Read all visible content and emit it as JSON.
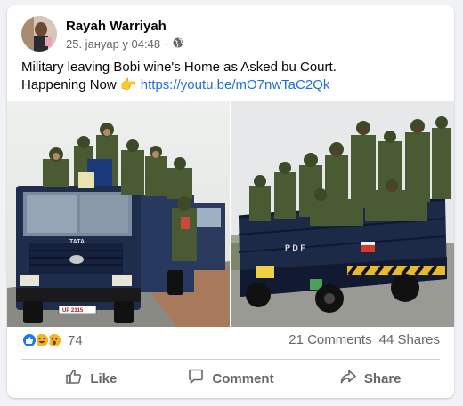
{
  "post": {
    "author": "Rayah Warriyah",
    "date": "25. јануар у 04:48",
    "separator": "·",
    "privacy_icon": "globe-icon",
    "text_line1": "Military leaving Bobi wine's Home as Asked bu Court.",
    "text_line2_prefix": "Happening Now ",
    "emoji": "👉",
    "link": "https://youtu.be/mO7nwTaC2Qk"
  },
  "stats": {
    "reaction_icons": [
      "like-icon",
      "haha-icon",
      "wow-icon"
    ],
    "reaction_count": "74",
    "comments": "21 Comments",
    "shares": "44 Shares"
  },
  "actions": {
    "like": "Like",
    "comment": "Comment",
    "share": "Share"
  },
  "photos": {
    "left_truck_plate": "UP 2315",
    "left_truck_brand": "TATA",
    "right_truck_lettering": "P  D  F",
    "right_truck_plate": "UP 2P..."
  },
  "colors": {
    "link": "#216fdb",
    "muted": "#65676b",
    "like_blue": "#1877f2",
    "reaction_yellow": "#f7b125",
    "truck_blue": "#1f2d4d",
    "uniform_green": "#4a5a32"
  }
}
